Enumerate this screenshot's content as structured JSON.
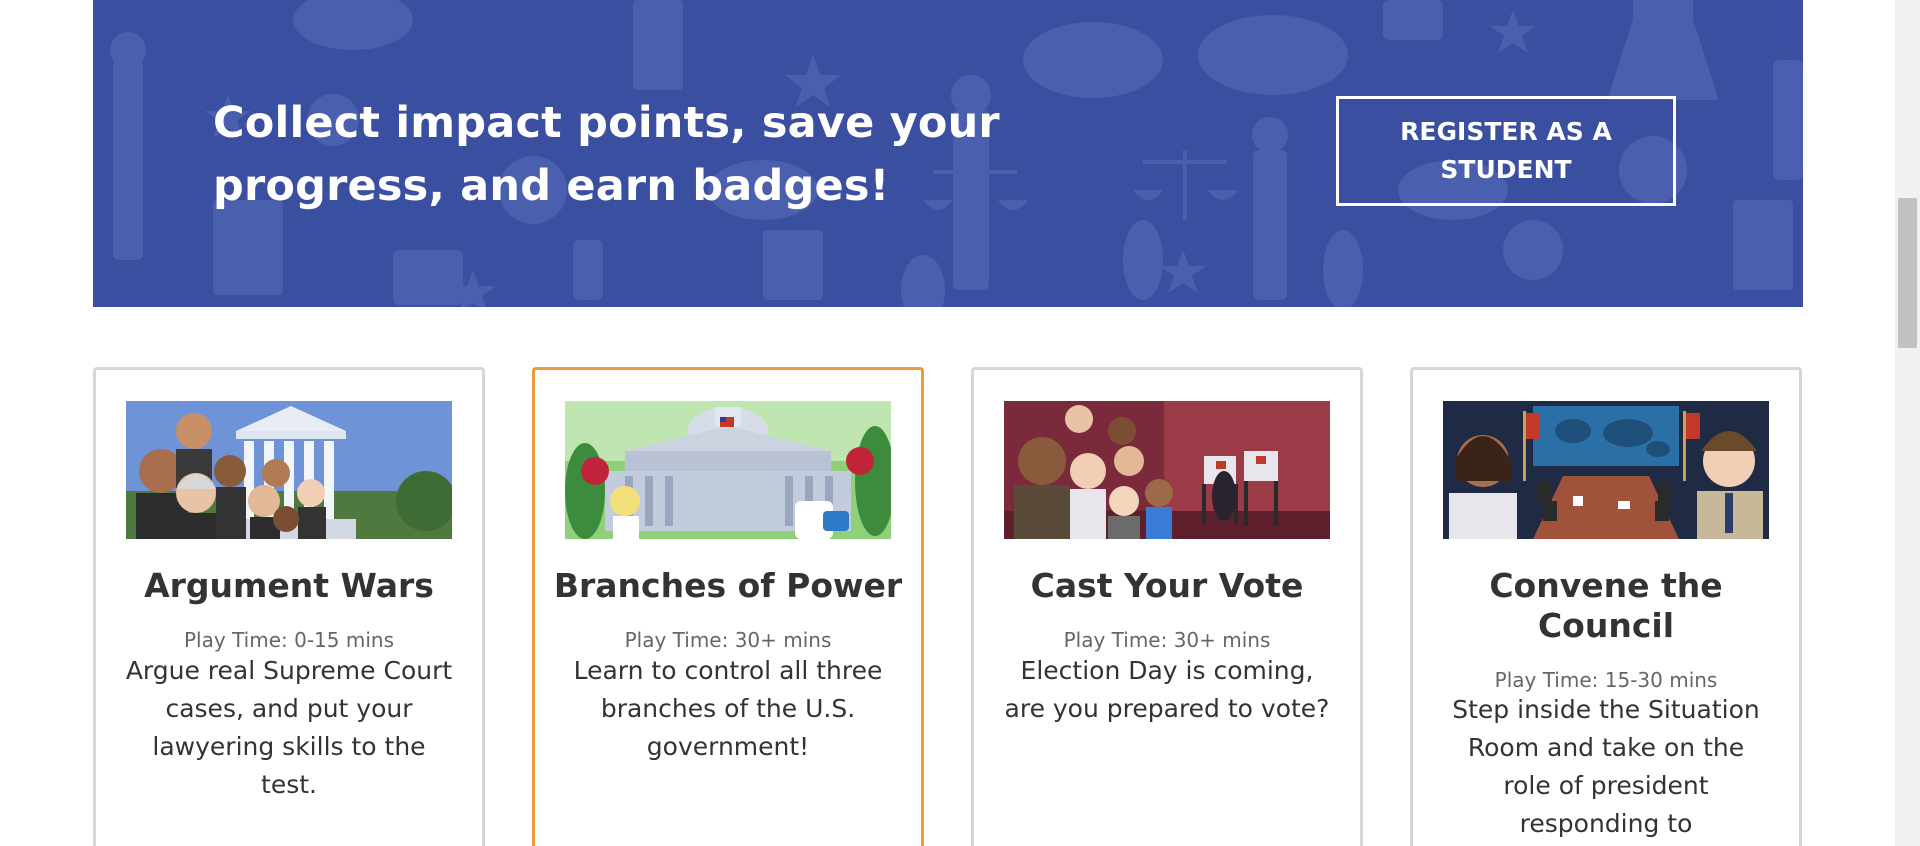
{
  "banner": {
    "heading": "Collect impact points, save your progress, and earn badges!",
    "register_label": "REGISTER AS A STUDENT",
    "colors": {
      "background": "#3a4fa0",
      "pattern": "#4a5fae",
      "text": "#ffffff"
    }
  },
  "cards": [
    {
      "title": "Argument Wars",
      "play_time": "Play Time: 0-15 mins",
      "description": "Argue real Supreme Court cases, and put your lawyering skills to the test.",
      "image": "argument-wars-illustration"
    },
    {
      "title": "Branches of Power",
      "play_time": "Play Time: 30+ mins",
      "description": "Learn to control all three branches of the U.S. government!",
      "image": "branches-of-power-illustration",
      "highlighted": true
    },
    {
      "title": "Cast Your Vote",
      "play_time": "Play Time: 30+ mins",
      "description": "Election Day is coming, are you prepared to vote?",
      "image": "cast-your-vote-illustration"
    },
    {
      "title": "Convene the Council",
      "play_time": "Play Time: 15-30 mins",
      "description": "Step inside the Situation Room and take on the role of president responding to international events.",
      "image": "convene-the-council-illustration"
    }
  ],
  "colors": {
    "card_border": "#d6d6d6",
    "card_highlight_border": "#f0993c",
    "title_text": "#333333",
    "meta_text": "#666666"
  }
}
